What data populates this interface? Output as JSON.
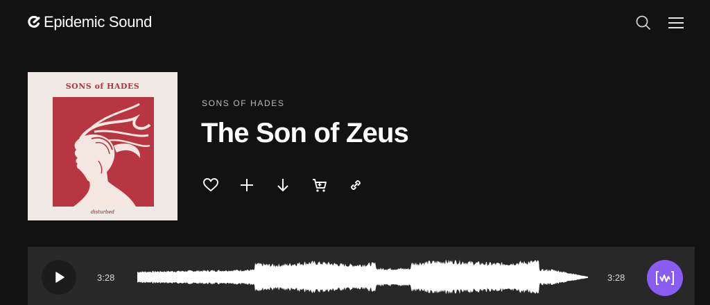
{
  "header": {
    "brand": "Epidemic Sound",
    "search_icon": "search-icon",
    "menu_icon": "hamburger-menu-icon"
  },
  "album": {
    "cover_artist_text": "SONS of HADES",
    "cover_signature": "disturbed"
  },
  "track": {
    "artist": "SONS OF HADES",
    "title": "The Son of Zeus"
  },
  "actions": [
    "heart-icon",
    "plus-icon",
    "download-icon",
    "cart-icon",
    "link-icon"
  ],
  "player": {
    "elapsed": "3:28",
    "total": "3:28",
    "play_icon": "play-icon",
    "studio_icon": "studio-waveform-icon"
  },
  "colors": {
    "background": "#121212",
    "player_background": "#282828",
    "accent": "#8a5cf6",
    "cover_red": "#b83642",
    "cover_cream": "#f1e9e6"
  }
}
